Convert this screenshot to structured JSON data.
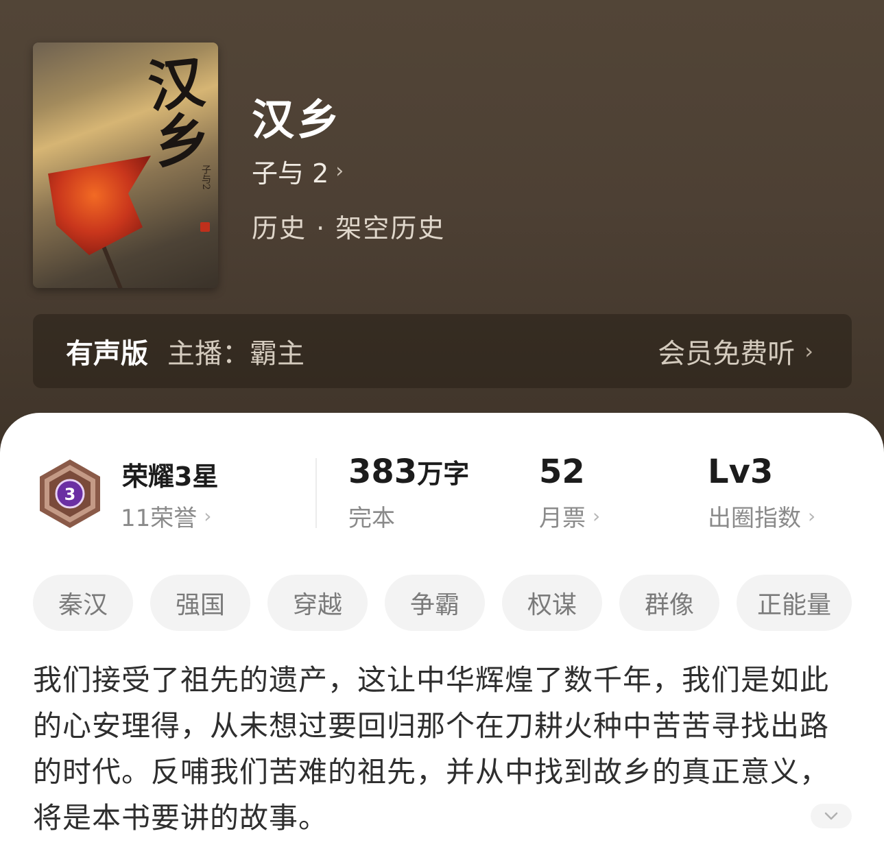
{
  "book": {
    "cover_text": "汉乡",
    "cover_author_text": "子与2",
    "title": "汉乡",
    "author": "子与 2",
    "genre": "历史 · 架空历史"
  },
  "audio": {
    "tag": "有声版",
    "host": "主播：霸主",
    "action": "会员免费听"
  },
  "stats": {
    "honor_level": "3",
    "honor_title": "荣耀3星",
    "honor_count": "11荣誉",
    "words_value": "383",
    "words_unit": "万字",
    "status": "完本",
    "votes_value": "52",
    "votes_label": "月票",
    "circle_value": "Lv3",
    "circle_label": "出圈指数"
  },
  "tags": [
    "秦汉",
    "强国",
    "穿越",
    "争霸",
    "权谋",
    "群像",
    "正能量"
  ],
  "description": "我们接受了祖先的遗产，这让中华辉煌了数千年，我们是如此的心安理得，从未想过要回归那个在刀耕火种中苦苦寻找出路的时代。反哺我们苦难的祖先，并从中找到故乡的真正意义，将是本书要讲的故事。",
  "colors": {
    "hero_bg": "#4d4034",
    "badge_purple": "#6b2fa3",
    "badge_bronze": "#8a5a48",
    "tag_bg": "#f3f3f3"
  },
  "icons": {
    "chevron": "chevron-right-icon",
    "expand": "chevron-down-icon",
    "badge": "honor-badge-icon"
  }
}
